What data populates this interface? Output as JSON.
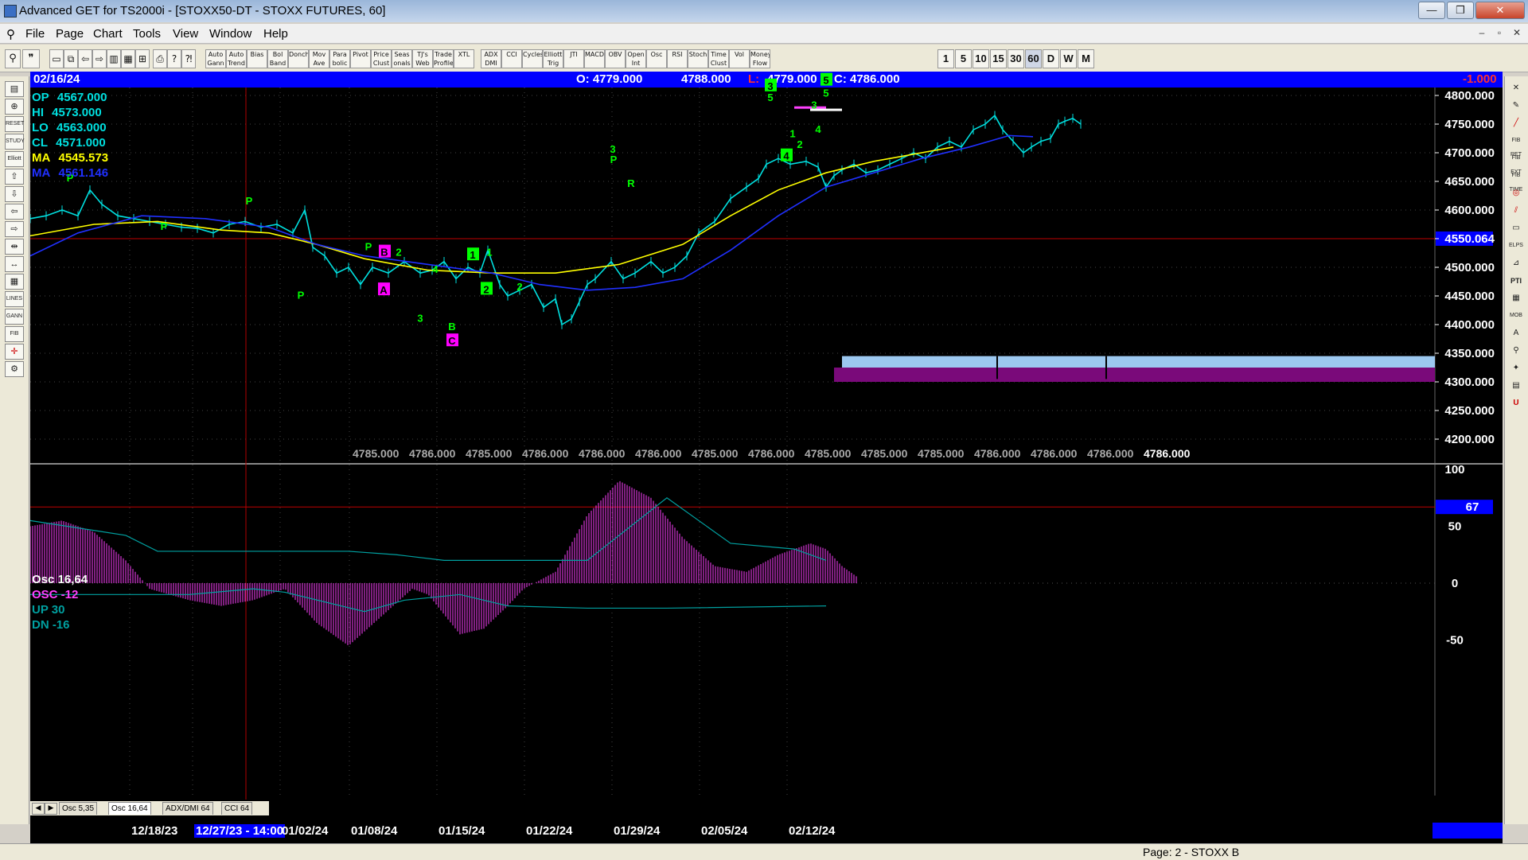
{
  "window": {
    "title": "Advanced GET for TS2000i - [STOXX50-DT - STOXX FUTURES, 60]",
    "min": "—",
    "max": "❒",
    "close": "✕"
  },
  "menu": {
    "items": [
      "File",
      "Page",
      "Chart",
      "Tools",
      "View",
      "Window",
      "Help"
    ]
  },
  "toolbar": {
    "groups": [
      {
        "label": "Auto Gann"
      },
      {
        "label": "Auto Trend"
      },
      {
        "label": "Bias"
      },
      {
        "label": "Bol Band"
      },
      {
        "label": "Donch"
      },
      {
        "label": "Mov Ave"
      },
      {
        "label": "Para bolic"
      },
      {
        "label": "Pivot"
      },
      {
        "label": "Price Clust"
      },
      {
        "label": "Seas onals"
      },
      {
        "label": "TJ's Web"
      },
      {
        "label": "Trade Profile"
      },
      {
        "label": "XTL"
      },
      {
        "label": "ADX DMI"
      },
      {
        "label": "CCI"
      },
      {
        "label": "Cycles"
      },
      {
        "label": "Elliott Trig"
      },
      {
        "label": "JTI"
      },
      {
        "label": "MACD"
      },
      {
        "label": "OBV"
      },
      {
        "label": "Open Int"
      },
      {
        "label": "Osc"
      },
      {
        "label": "RSI"
      },
      {
        "label": "Stoch"
      },
      {
        "label": "Time Clust"
      },
      {
        "label": "Vol"
      },
      {
        "label": "Money Flow"
      }
    ],
    "timeframes": [
      "1",
      "5",
      "10",
      "15",
      "30",
      "60",
      "D",
      "W",
      "M"
    ],
    "active_timeframe": "60"
  },
  "info_bar": {
    "date": "02/16/24",
    "open": "O: 4779.000",
    "high": "4788.000",
    "low_label": "L:",
    "low": "4779.000",
    "close": "C: 4786.000",
    "change": "-1.000"
  },
  "price_legend": [
    {
      "label": "OP",
      "value": "4567.000",
      "color": "#00e0e0"
    },
    {
      "label": "HI",
      "value": "4573.000",
      "color": "#00e0e0"
    },
    {
      "label": "LO",
      "value": "4563.000",
      "color": "#00e0e0"
    },
    {
      "label": "CL",
      "value": "4571.000",
      "color": "#00e0e0"
    },
    {
      "label": "MA",
      "value": "4545.573",
      "color": "#ffff00"
    },
    {
      "label": "MA",
      "value": "4561.146",
      "color": "#2030ff"
    }
  ],
  "price_axis": {
    "ticks": [
      "4800.000",
      "4750.000",
      "4700.000",
      "4650.000",
      "4600.000",
      "4550.064",
      "4500.000",
      "4450.000",
      "4400.000",
      "4350.000",
      "4300.000",
      "4250.000",
      "4200.000"
    ],
    "highlight": "4550.064"
  },
  "bottom_prices": [
    "4785.000",
    "4786.000",
    "4785.000",
    "4786.000",
    "4786.000",
    "4786.000",
    "4785.000",
    "4786.000",
    "4785.000",
    "4785.000",
    "4785.000",
    "4786.000",
    "4786.000",
    "4786.000",
    "4786.000"
  ],
  "elliott_labels": [
    "P",
    "P",
    "P",
    "P",
    "P",
    "B",
    "2",
    "A",
    "3",
    "C",
    "4",
    "B",
    "1",
    "1",
    "2",
    "2",
    "3",
    "P",
    "R",
    "R",
    "3",
    "5",
    "5",
    "5",
    "1",
    "2",
    "3",
    "4",
    "4"
  ],
  "oscillator": {
    "legend": [
      {
        "label": "Osc 16,64",
        "color": "#ffffff"
      },
      {
        "label": "OSC -12",
        "color": "#ff40ff"
      },
      {
        "label": "UP  30",
        "color": "#00a0a0"
      },
      {
        "label": "DN  -16",
        "color": "#00a0a0"
      }
    ],
    "axis": [
      "100",
      "67",
      "50",
      "0",
      "-50"
    ],
    "highlight": "67"
  },
  "study_tabs": [
    "Osc 5,35",
    "Osc 16,64",
    "ADX/DMI 64",
    "CCI 64"
  ],
  "active_study_tab": "Osc 16,64",
  "date_axis": [
    "12/18/23",
    "12/27/23 - 14:00",
    "01/02/24",
    "01/08/24",
    "01/15/24",
    "01/22/24",
    "01/29/24",
    "02/05/24",
    "02/12/24"
  ],
  "status": {
    "text": "Page: 2 - STOXX B"
  },
  "colors": {
    "price_line": "#00e0e0",
    "ma_fast": "#ffff00",
    "ma_slow": "#2030ff",
    "osc": "#ff40ff",
    "accent_blue": "#0000ff"
  }
}
